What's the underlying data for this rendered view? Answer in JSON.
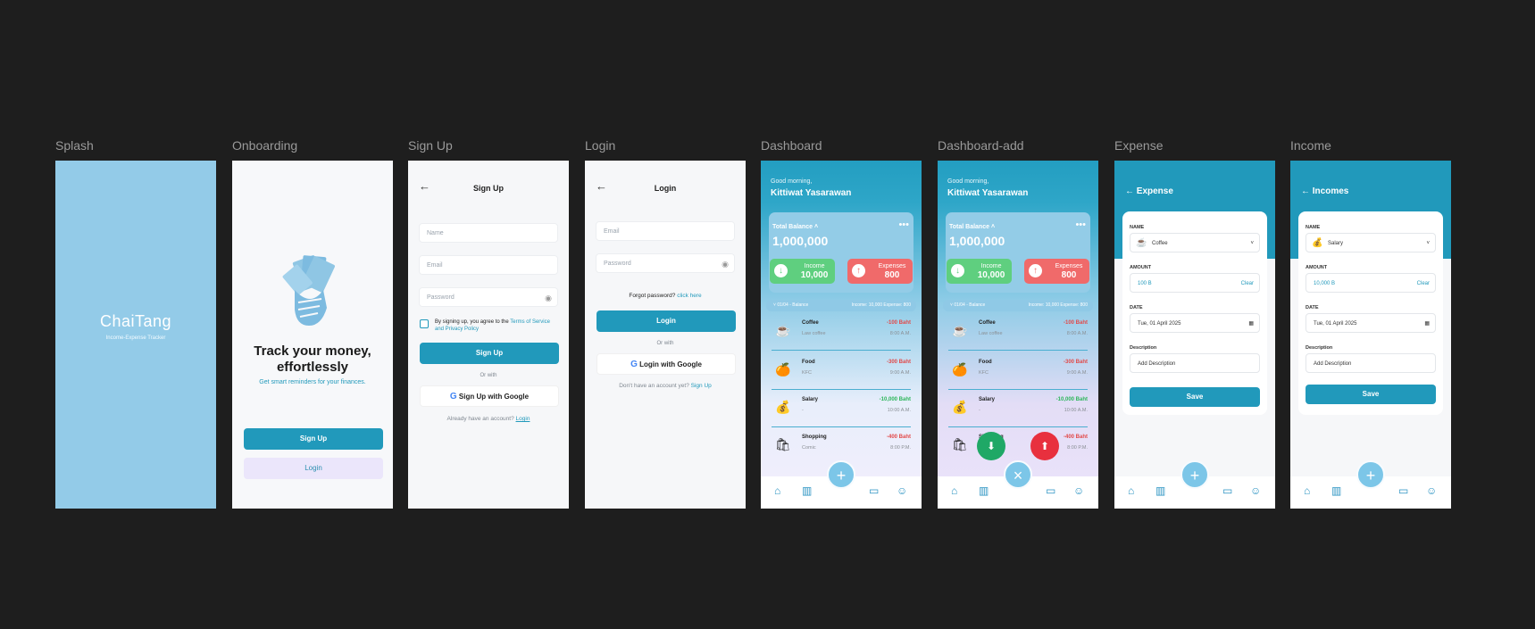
{
  "frames": {
    "splash": "Splash",
    "onboarding": "Onboarding",
    "signup": "Sign Up",
    "login": "Login",
    "dashboard": "Dashboard",
    "dashboard_add": "Dashboard-add",
    "expense": "Expense",
    "income": "Income"
  },
  "splash": {
    "app_name": "ChaiTang",
    "tagline": "Income-Expense Tracker"
  },
  "onboarding": {
    "headline": "Track your money, effortlessly",
    "subtext": "Get smart reminders for your finances.",
    "signup_button": "Sign Up",
    "login_button": "Login"
  },
  "signup": {
    "title": "Sign Up",
    "name_placeholder": "Name",
    "email_placeholder": "Email",
    "password_placeholder": "Password",
    "terms_prefix": "By signing up, you agree to the",
    "terms_link": "Terms of Service and Privacy Policy",
    "signup_button": "Sign Up",
    "or_with": "Or with",
    "google_button": "Sign Up with Google",
    "have_account": "Already have an account?",
    "login_link": "Login"
  },
  "login": {
    "title": "Login",
    "email_placeholder": "Email",
    "password_placeholder": "Password",
    "forgot": "Forgot password?",
    "click_here": "click here",
    "login_button": "Login",
    "or_with": "Or with",
    "google_button": "Login with Google",
    "no_account": "Don't have an account yet?",
    "signup_link": "Sign Up"
  },
  "dashboard": {
    "greeting": "Good morning,",
    "user_name": "Kittiwat Yasarawan",
    "total_balance_label": "Total Balance",
    "total_balance": "1,000,000",
    "income_label": "Income",
    "income_value": "10,000",
    "expenses_label": "Expenses",
    "expenses_value": "800",
    "summary_date": "01/04 - Balance",
    "summary_totals": "Income: 10,000 Expense: 800",
    "transactions": [
      {
        "name": "Coffee",
        "desc": "Law coffee",
        "amount": "-100 Baht",
        "time": "8:00 A.M.",
        "icon": "coffee-icon",
        "kind": "neg"
      },
      {
        "name": "Food",
        "desc": "KFC",
        "amount": "-300 Baht",
        "time": "9:00 A.M.",
        "icon": "food-icon",
        "kind": "neg"
      },
      {
        "name": "Salary",
        "desc": "-",
        "amount": "-10,000 Baht",
        "time": "10:00 A.M.",
        "icon": "money-bag-icon",
        "kind": "pos"
      },
      {
        "name": "Shopping",
        "desc": "Comic",
        "amount": "-400 Baht",
        "time": "8:00 P.M.",
        "icon": "shopping-icon",
        "kind": "neg"
      }
    ]
  },
  "expense": {
    "title": "Expense",
    "name_label": "NAME",
    "name_value": "Coffee",
    "amount_label": "AMOUNT",
    "amount_value": "100 B",
    "clear": "Clear",
    "date_label": "DATE",
    "date_value": "Tue, 01 April 2025",
    "description_label": "Description",
    "description_placeholder": "Add Description",
    "save": "Save"
  },
  "income": {
    "title": "Incomes",
    "name_label": "NAME",
    "name_value": "Salary",
    "amount_label": "AMOUNT",
    "amount_value": "10,000 B",
    "clear": "Clear",
    "date_label": "DATE",
    "date_value": "Tue, 01 April 2025",
    "description_label": "Description",
    "description_placeholder": "Add Description",
    "save": "Save"
  },
  "colors": {
    "primary": "#2199bb",
    "light_blue": "#93cce7",
    "income_green": "#5fcf7f",
    "expense_red": "#f06a6a",
    "bg": "#1e1e1e"
  }
}
